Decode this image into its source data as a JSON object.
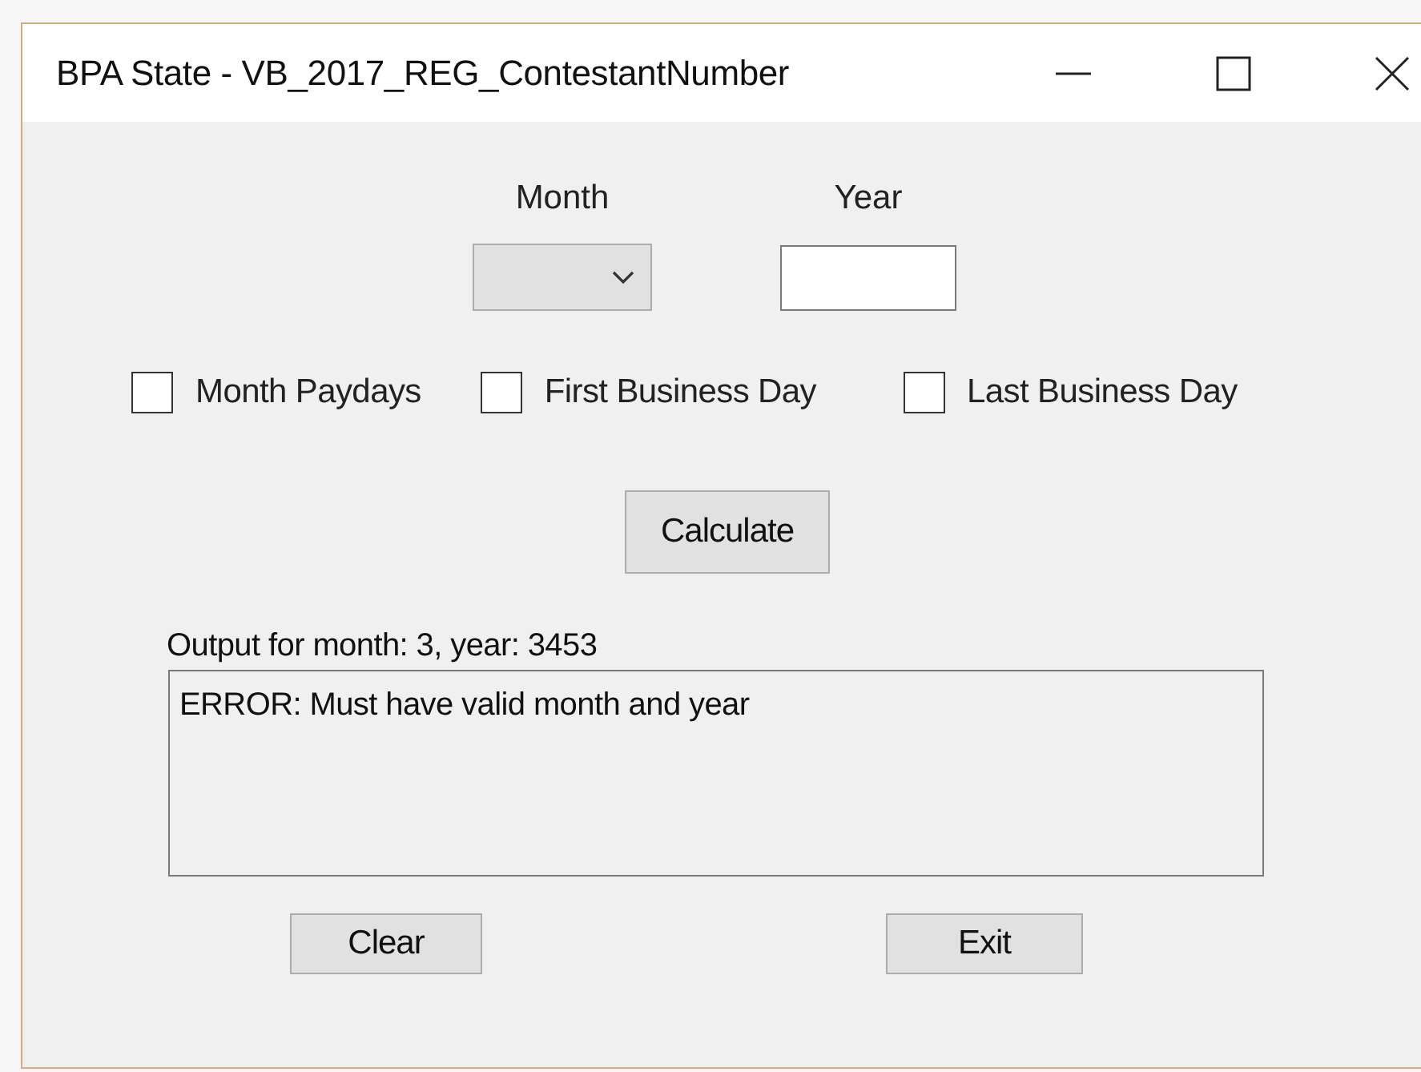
{
  "window": {
    "title": "BPA State - VB_2017_REG_ContestantNumber"
  },
  "month": {
    "label": "Month"
  },
  "year": {
    "label": "Year"
  },
  "options": [
    {
      "label": "Month Paydays",
      "checked": false
    },
    {
      "label": "First Business Day",
      "checked": false
    },
    {
      "label": "Last Business Day",
      "checked": false
    }
  ],
  "calculate_button": "Calculate",
  "output": {
    "label": "Output for month: 3, year: 3453",
    "text": "ERROR: Must have valid month and year"
  },
  "buttons": [
    "Clear",
    "Exit"
  ]
}
